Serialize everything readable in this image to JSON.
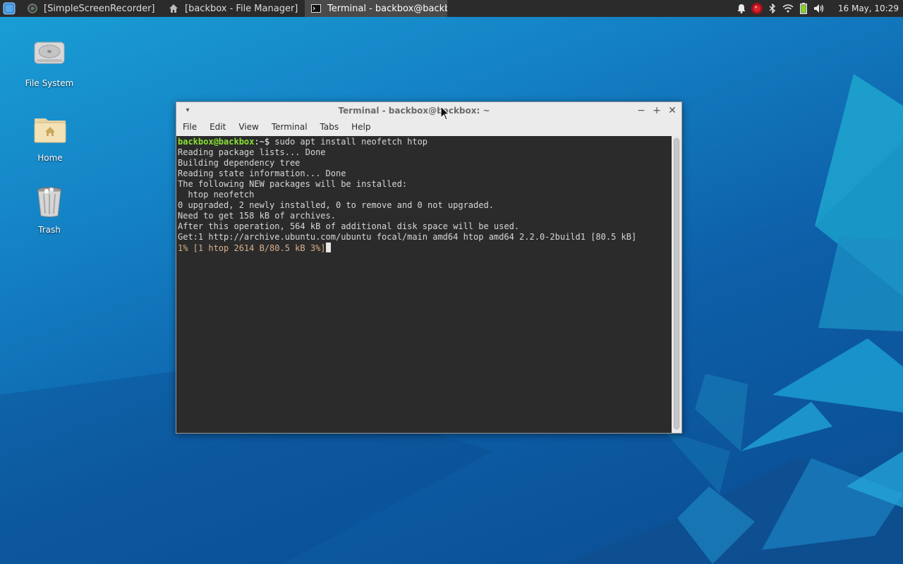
{
  "taskbar": {
    "tasks": [
      {
        "label": "[SimpleScreenRecorder]",
        "icon": "screen-recorder-icon"
      },
      {
        "label": "[backbox - File Manager]",
        "icon": "home-folder-icon"
      },
      {
        "label": "Terminal - backbox@backbo...",
        "icon": "terminal-icon"
      }
    ],
    "clock": "16 May, 10:29"
  },
  "desktop_icons": [
    {
      "label": "File System",
      "icon": "drive-icon"
    },
    {
      "label": "Home",
      "icon": "home-folder-icon"
    },
    {
      "label": "Trash",
      "icon": "trash-icon"
    }
  ],
  "window": {
    "title": "Terminal - backbox@backbox: ~",
    "menu": [
      "File",
      "Edit",
      "View",
      "Terminal",
      "Tabs",
      "Help"
    ]
  },
  "terminal": {
    "prompt_user": "backbox@backbox",
    "prompt_sep": ":~$",
    "command": " sudo apt install neofetch htop",
    "lines": [
      "Reading package lists... Done",
      "Building dependency tree",
      "Reading state information... Done",
      "The following NEW packages will be installed:",
      "  htop neofetch",
      "0 upgraded, 2 newly installed, 0 to remove and 0 not upgraded.",
      "Need to get 158 kB of archives.",
      "After this operation, 564 kB of additional disk space will be used.",
      "Get:1 http://archive.ubuntu.com/ubuntu focal/main amd64 htop amd64 2.2.0-2build1 [80.5 kB]"
    ],
    "progress": "1% [1 htop 2614 B/80.5 kB 3%]"
  },
  "colors": {
    "prompt_green": "#8ae234",
    "progress_text": "#d8b08c",
    "panel_bg": "#2b2b2b",
    "terminal_bg": "#2b2b2b"
  }
}
